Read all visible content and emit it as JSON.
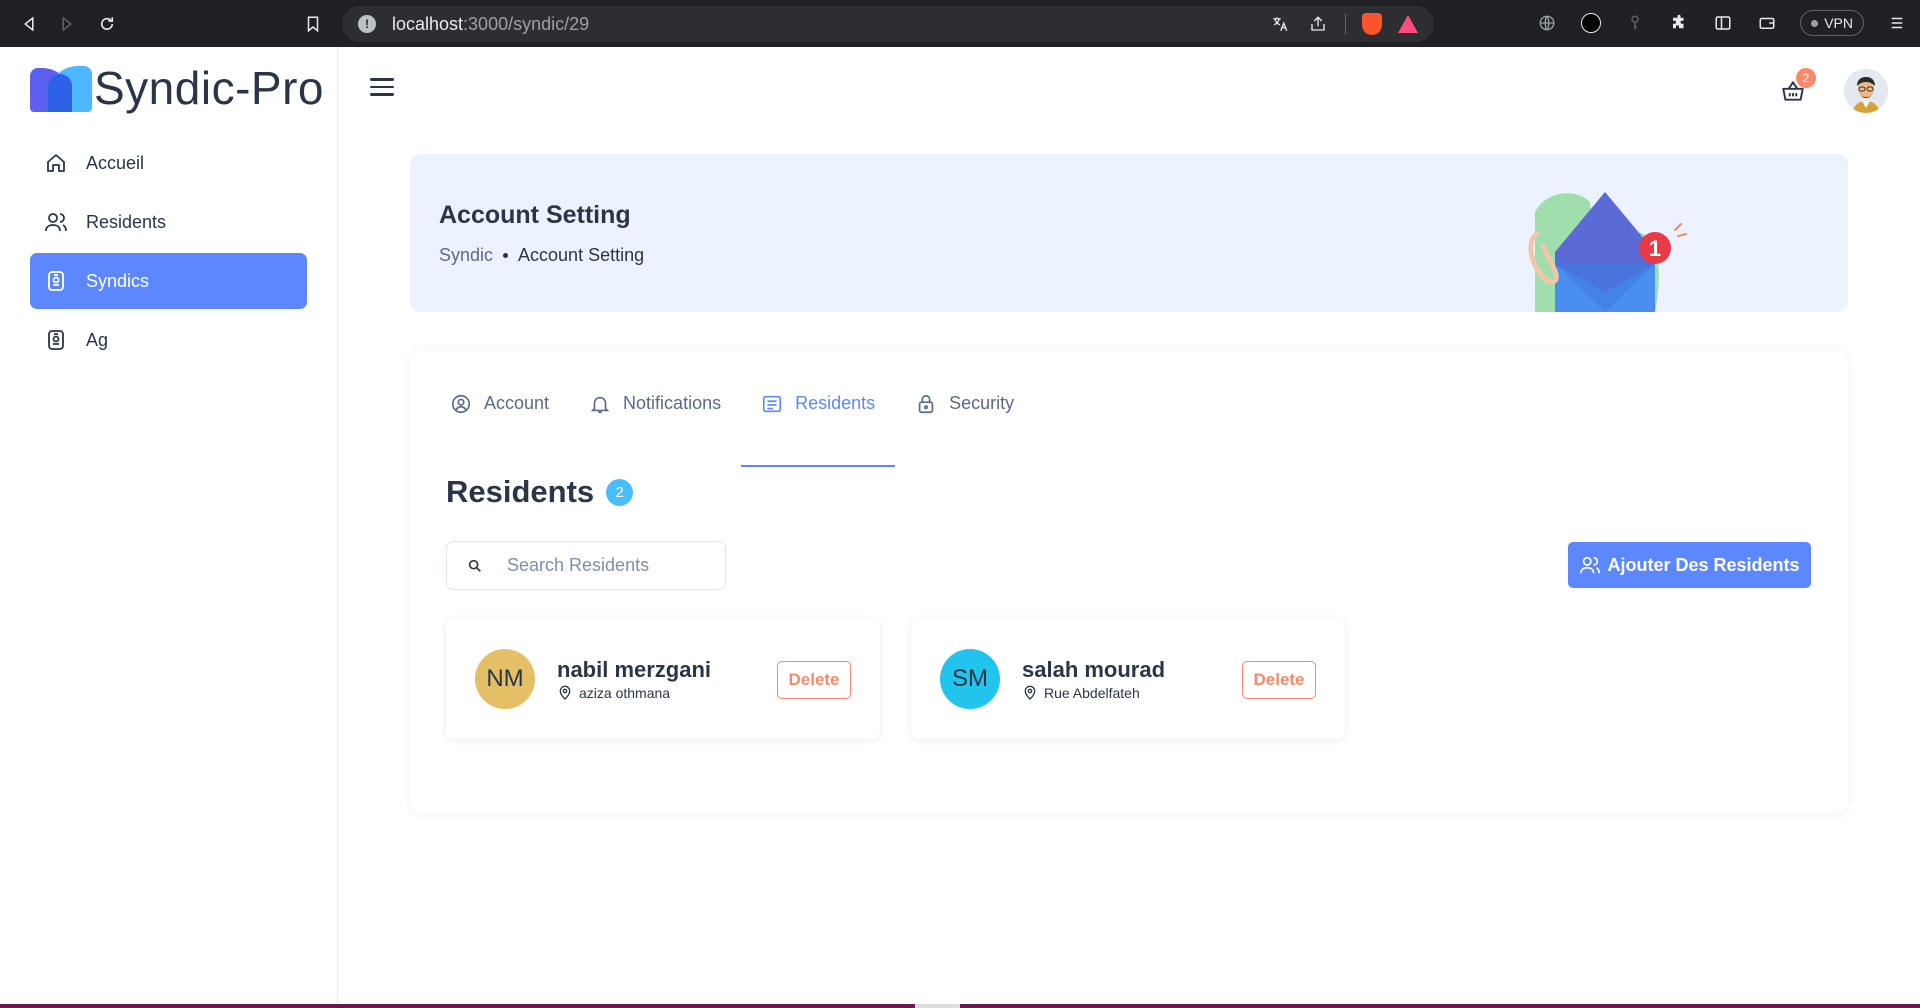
{
  "browser": {
    "url_host": "localhost",
    "url_path": ":3000/syndic/29",
    "vpn_label": "VPN"
  },
  "app": {
    "logo_text": "Syndic-Pro",
    "brand_color": "#5d87ff"
  },
  "sidebar": {
    "items": [
      {
        "label": "Accueil",
        "icon": "home-icon",
        "active": false
      },
      {
        "label": "Residents",
        "icon": "users-icon",
        "active": false
      },
      {
        "label": "Syndics",
        "icon": "badge-icon",
        "active": true
      },
      {
        "label": "Ag",
        "icon": "badge-icon",
        "active": false
      }
    ]
  },
  "header": {
    "cart_count": "2"
  },
  "banner": {
    "title": "Account Setting",
    "breadcrumb": [
      "Syndic",
      "Account Setting"
    ],
    "envelope_badge": "1"
  },
  "tabs": [
    {
      "label": "Account",
      "icon": "user-circle-icon",
      "active": false
    },
    {
      "label": "Notifications",
      "icon": "bell-icon",
      "active": false
    },
    {
      "label": "Residents",
      "icon": "list-icon",
      "active": true
    },
    {
      "label": "Security",
      "icon": "lock-icon",
      "active": false
    }
  ],
  "residents_section": {
    "title": "Residents",
    "count": "2",
    "search_placeholder": "Search Residents",
    "add_button_label": "Ajouter Des Residents"
  },
  "residents": [
    {
      "initials": "NM",
      "name": "nabil merzgani",
      "location": "aziza othmana",
      "avatar_color": "#e5bf66",
      "delete_label": "Delete"
    },
    {
      "initials": "SM",
      "name": "salah mourad",
      "location": "Rue Abdelfateh",
      "avatar_color": "#21c4ec",
      "delete_label": "Delete"
    }
  ]
}
